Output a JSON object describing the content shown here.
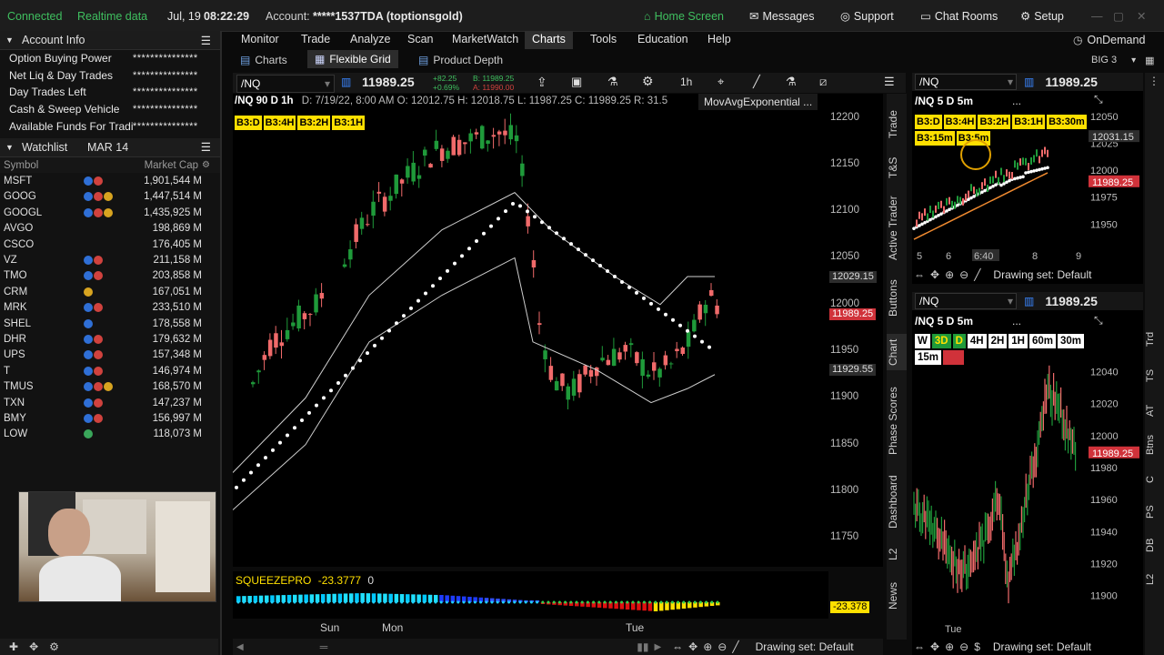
{
  "status": {
    "connected": "Connected",
    "realtime": "Realtime data",
    "date": "Jul, 19",
    "time": "08:22:29",
    "account_label": "Account:",
    "account": "*****1537TDA (toptionsgold)",
    "home": "Home Screen",
    "messages": "Messages",
    "support": "Support",
    "chatrooms": "Chat Rooms",
    "setup": "Setup"
  },
  "account_info": {
    "title": "Account Info",
    "rows": [
      {
        "label": "Option Buying Power",
        "value": "***************"
      },
      {
        "label": "Net Liq & Day Trades",
        "value": "***************"
      },
      {
        "label": "Day Trades Left",
        "value": "***************"
      },
      {
        "label": "Cash & Sweep Vehicle",
        "value": "***************"
      },
      {
        "label": "Available Funds For Trading",
        "value": "***************"
      }
    ]
  },
  "watchlist": {
    "title": "Watchlist",
    "date": "MAR 14",
    "col_symbol": "Symbol",
    "col_cap": "Market Cap",
    "rows": [
      {
        "sym": "MSFT",
        "cap": "1,901,544 M",
        "icons": [
          "blue",
          "red"
        ]
      },
      {
        "sym": "GOOG",
        "cap": "1,447,514 M",
        "icons": [
          "blue",
          "red",
          "yel"
        ]
      },
      {
        "sym": "GOOGL",
        "cap": "1,435,925 M",
        "icons": [
          "blue",
          "red",
          "yel"
        ]
      },
      {
        "sym": "AVGO",
        "cap": "198,869 M",
        "icons": []
      },
      {
        "sym": "CSCO",
        "cap": "176,405 M",
        "icons": []
      },
      {
        "sym": "VZ",
        "cap": "211,158 M",
        "icons": [
          "blue",
          "red"
        ]
      },
      {
        "sym": "TMO",
        "cap": "203,858 M",
        "icons": [
          "blue",
          "red"
        ]
      },
      {
        "sym": "CRM",
        "cap": "167,051 M",
        "icons": [
          "yel"
        ]
      },
      {
        "sym": "MRK",
        "cap": "233,510 M",
        "icons": [
          "blue",
          "red"
        ]
      },
      {
        "sym": "SHEL",
        "cap": "178,558 M",
        "icons": [
          "blue"
        ]
      },
      {
        "sym": "DHR",
        "cap": "179,632 M",
        "icons": [
          "blue",
          "red"
        ]
      },
      {
        "sym": "UPS",
        "cap": "157,348 M",
        "icons": [
          "blue",
          "red"
        ]
      },
      {
        "sym": "T",
        "cap": "146,974 M",
        "icons": [
          "blue",
          "red"
        ]
      },
      {
        "sym": "TMUS",
        "cap": "168,570 M",
        "icons": [
          "blue",
          "red",
          "yel"
        ]
      },
      {
        "sym": "TXN",
        "cap": "147,237 M",
        "icons": [
          "blue",
          "red"
        ]
      },
      {
        "sym": "BMY",
        "cap": "156,997 M",
        "icons": [
          "blue",
          "red"
        ]
      },
      {
        "sym": "LOW",
        "cap": "118,073 M",
        "icons": [
          "grn"
        ]
      }
    ]
  },
  "nav": {
    "items": [
      "Monitor",
      "Trade",
      "Analyze",
      "Scan",
      "MarketWatch",
      "Charts",
      "Tools",
      "Education",
      "Help"
    ],
    "ondemand": "OnDemand",
    "big3": "BIG 3",
    "sub": [
      "Charts",
      "Flexible Grid",
      "Product Depth"
    ]
  },
  "main_chart": {
    "symbol": "/NQ",
    "price": "11989.25",
    "change": "+82.25",
    "change_pct": "+0.69%",
    "bid": "B: 11989.25",
    "ask": "A: 11990.00",
    "timeframe": "1h",
    "info": "/NQ 90 D 1h",
    "ohlc": "D: 7/19/22, 8:00 AM  O: 12012.75  H: 12018.75  L: 11987.25  C: 11989.25  R: 31.5",
    "study": "MovAvgExponential ...",
    "tags": [
      "B3:D",
      "B3:4H",
      "B3:2H",
      "B3:1H"
    ],
    "squeeze_label": "SQUEEZEPRO",
    "squeeze_value": "-23.3777",
    "squeeze_zero": "0",
    "squeeze_tag": "-23.378",
    "x_labels": [
      "Sun",
      "Mon",
      "Tue"
    ],
    "drawing_set": "Drawing set: Default",
    "price_tags": [
      {
        "text": "12029.15",
        "type": "gray"
      },
      {
        "text": "11989.25",
        "type": "red"
      },
      {
        "text": "11929.55",
        "type": "gray"
      }
    ]
  },
  "chart_data": {
    "type": "candlestick",
    "title": "/NQ 90 D 1h",
    "ylim": [
      11725,
      12220
    ],
    "y_ticks": [
      12200,
      12150,
      12100,
      12050,
      12000,
      11950,
      11900,
      11850,
      11800,
      11750
    ],
    "x_labels": [
      "Sun",
      "Mon",
      "Tue"
    ]
  },
  "vtabs": [
    "Trade",
    "T&S",
    "Active Trader",
    "Buttons",
    "Chart",
    "Phase Scores",
    "Dashboard",
    "L2",
    "News"
  ],
  "mini1": {
    "symbol": "/NQ",
    "price": "11989.25",
    "info": "/NQ 5 D 5m",
    "tags": [
      "B3:D",
      "B3:4H",
      "B3:2H",
      "B3:1H",
      "B3:30m",
      "B3:15m",
      "B3:5m"
    ],
    "y_ticks": [
      "12050",
      "12025",
      "12000",
      "11975",
      "11950"
    ],
    "x_labels": [
      "5",
      "6",
      "6:40",
      "8",
      "9"
    ],
    "price_tags": [
      "12031.15",
      "11989.25"
    ],
    "drawing_set": "Drawing set: Default"
  },
  "mini2": {
    "symbol": "/NQ",
    "price": "11989.25",
    "info": "/NQ 5 D 5m",
    "tags": [
      "W",
      "3D",
      "D",
      "4H",
      "2H",
      "1H",
      "60m",
      "30m",
      "15m",
      "5m"
    ],
    "y_ticks": [
      "12040",
      "12020",
      "12000",
      "11980",
      "11960",
      "11940",
      "11920",
      "11900"
    ],
    "x_labels": [
      "Tue"
    ],
    "price_tag": "11989.25",
    "drawing_set": "Drawing set: Default"
  },
  "right_tabs": [
    "Trd",
    "TS",
    "AT",
    "Btns",
    "C",
    "PS",
    "DB",
    "L2"
  ]
}
